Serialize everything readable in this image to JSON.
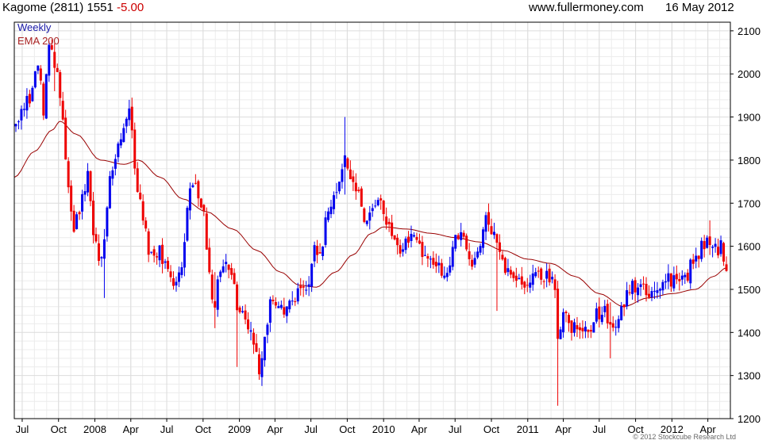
{
  "header": {
    "symbol": "Kagome (2811)",
    "price": "1551",
    "change": "-5.00",
    "site": "www.fullermoney.com",
    "date": "16 May 2012"
  },
  "legend": {
    "weekly": "Weekly",
    "ema": "EMA 200"
  },
  "copyright": "© 2012 Stockcube Research Ltd",
  "colors": {
    "up": "#0000ee",
    "down": "#ee0000",
    "ema": "#990000",
    "grid": "#dcdcdc",
    "frame": "#000000"
  },
  "chart_data": {
    "type": "candlestick",
    "ylim": [
      1200,
      2120
    ],
    "yticks": [
      1200,
      1300,
      1400,
      1500,
      1600,
      1700,
      1800,
      1900,
      2000,
      2100
    ],
    "x_range": [
      "2007-06-11",
      "2012-05-28"
    ],
    "xticks": [
      {
        "date": "2007-07-01",
        "label": "Jul"
      },
      {
        "date": "2007-10-01",
        "label": "Oct"
      },
      {
        "date": "2008-01-01",
        "label": "2008"
      },
      {
        "date": "2008-04-01",
        "label": "Apr"
      },
      {
        "date": "2008-07-01",
        "label": "Jul"
      },
      {
        "date": "2008-10-01",
        "label": "Oct"
      },
      {
        "date": "2009-01-01",
        "label": "2009"
      },
      {
        "date": "2009-04-01",
        "label": "Apr"
      },
      {
        "date": "2009-07-01",
        "label": "Jul"
      },
      {
        "date": "2009-10-01",
        "label": "Oct"
      },
      {
        "date": "2010-01-01",
        "label": "2010"
      },
      {
        "date": "2010-04-01",
        "label": "Apr"
      },
      {
        "date": "2010-07-01",
        "label": "Jul"
      },
      {
        "date": "2010-10-01",
        "label": "Oct"
      },
      {
        "date": "2011-01-01",
        "label": "2011"
      },
      {
        "date": "2011-04-01",
        "label": "Apr"
      },
      {
        "date": "2011-07-01",
        "label": "Jul"
      },
      {
        "date": "2011-10-01",
        "label": "Oct"
      },
      {
        "date": "2012-01-01",
        "label": "2012"
      },
      {
        "date": "2012-04-01",
        "label": "Apr"
      }
    ],
    "grid": true,
    "price_anchors": [
      [
        "2007-06-15",
        1885
      ],
      [
        "2007-07-20",
        1950
      ],
      [
        "2007-08-10",
        2030
      ],
      [
        "2007-08-24",
        1920
      ],
      [
        "2007-09-07",
        2060
      ],
      [
        "2007-09-28",
        2010
      ],
      [
        "2007-10-12",
        1880
      ],
      [
        "2007-10-26",
        1720
      ],
      [
        "2007-11-09",
        1640
      ],
      [
        "2007-11-30",
        1710
      ],
      [
        "2007-12-14",
        1780
      ],
      [
        "2007-12-28",
        1620
      ],
      [
        "2008-01-18",
        1560
      ],
      [
        "2008-02-08",
        1760
      ],
      [
        "2008-02-22",
        1800
      ],
      [
        "2008-03-14",
        1870
      ],
      [
        "2008-03-28",
        1930
      ],
      [
        "2008-04-11",
        1780
      ],
      [
        "2008-04-25",
        1700
      ],
      [
        "2008-05-16",
        1600
      ],
      [
        "2008-05-30",
        1560
      ],
      [
        "2008-06-13",
        1600
      ],
      [
        "2008-06-27",
        1550
      ],
      [
        "2008-07-18",
        1510
      ],
      [
        "2008-08-08",
        1540
      ],
      [
        "2008-08-22",
        1700
      ],
      [
        "2008-09-05",
        1740
      ],
      [
        "2008-09-19",
        1720
      ],
      [
        "2008-10-03",
        1680
      ],
      [
        "2008-10-17",
        1520
      ],
      [
        "2008-10-31",
        1470
      ],
      [
        "2008-11-14",
        1560
      ],
      [
        "2008-11-28",
        1570
      ],
      [
        "2008-12-12",
        1520
      ],
      [
        "2008-12-26",
        1470
      ],
      [
        "2009-01-16",
        1450
      ],
      [
        "2009-02-06",
        1370
      ],
      [
        "2009-02-20",
        1320
      ],
      [
        "2009-03-06",
        1400
      ],
      [
        "2009-03-20",
        1460
      ],
      [
        "2009-04-10",
        1460
      ],
      [
        "2009-04-24",
        1430
      ],
      [
        "2009-05-15",
        1470
      ],
      [
        "2009-05-29",
        1500
      ],
      [
        "2009-06-12",
        1490
      ],
      [
        "2009-06-26",
        1530
      ],
      [
        "2009-07-10",
        1600
      ],
      [
        "2009-07-24",
        1580
      ],
      [
        "2009-08-07",
        1650
      ],
      [
        "2009-08-21",
        1700
      ],
      [
        "2009-09-04",
        1720
      ],
      [
        "2009-09-18",
        1780
      ],
      [
        "2009-09-25",
        1820
      ],
      [
        "2009-10-09",
        1770
      ],
      [
        "2009-10-23",
        1730
      ],
      [
        "2009-11-06",
        1690
      ],
      [
        "2009-11-20",
        1640
      ],
      [
        "2009-12-04",
        1680
      ],
      [
        "2009-12-18",
        1700
      ],
      [
        "2010-01-08",
        1660
      ],
      [
        "2010-01-22",
        1640
      ],
      [
        "2010-02-05",
        1590
      ],
      [
        "2010-02-19",
        1600
      ],
      [
        "2010-03-05",
        1620
      ],
      [
        "2010-03-19",
        1630
      ],
      [
        "2010-04-02",
        1600
      ],
      [
        "2010-04-16",
        1590
      ],
      [
        "2010-04-30",
        1580
      ],
      [
        "2010-05-14",
        1570
      ],
      [
        "2010-05-28",
        1520
      ],
      [
        "2010-06-11",
        1540
      ],
      [
        "2010-06-25",
        1600
      ],
      [
        "2010-07-09",
        1630
      ],
      [
        "2010-07-23",
        1620
      ],
      [
        "2010-08-06",
        1580
      ],
      [
        "2010-08-20",
        1560
      ],
      [
        "2010-09-03",
        1610
      ],
      [
        "2010-09-17",
        1660
      ],
      [
        "2010-10-01",
        1640
      ],
      [
        "2010-10-15",
        1590
      ],
      [
        "2010-10-29",
        1560
      ],
      [
        "2010-11-12",
        1540
      ],
      [
        "2010-11-26",
        1530
      ],
      [
        "2010-12-10",
        1510
      ],
      [
        "2010-12-24",
        1520
      ],
      [
        "2011-01-14",
        1520
      ],
      [
        "2011-02-04",
        1540
      ],
      [
        "2011-02-25",
        1520
      ],
      [
        "2011-03-11",
        1510
      ],
      [
        "2011-03-18",
        1400
      ],
      [
        "2011-04-01",
        1450
      ],
      [
        "2011-04-15",
        1420
      ],
      [
        "2011-05-06",
        1400
      ],
      [
        "2011-05-20",
        1420
      ],
      [
        "2011-06-10",
        1420
      ],
      [
        "2011-06-24",
        1440
      ],
      [
        "2011-07-08",
        1460
      ],
      [
        "2011-07-22",
        1430
      ],
      [
        "2011-08-05",
        1400
      ],
      [
        "2011-08-19",
        1440
      ],
      [
        "2011-09-02",
        1470
      ],
      [
        "2011-09-16",
        1500
      ],
      [
        "2011-09-30",
        1510
      ],
      [
        "2011-10-14",
        1500
      ],
      [
        "2011-10-28",
        1490
      ],
      [
        "2011-11-11",
        1510
      ],
      [
        "2011-11-25",
        1500
      ],
      [
        "2011-12-09",
        1510
      ],
      [
        "2011-12-23",
        1520
      ],
      [
        "2012-01-13",
        1520
      ],
      [
        "2012-01-27",
        1530
      ],
      [
        "2012-02-10",
        1540
      ],
      [
        "2012-02-24",
        1560
      ],
      [
        "2012-03-09",
        1590
      ],
      [
        "2012-03-23",
        1610
      ],
      [
        "2012-04-06",
        1600
      ],
      [
        "2012-04-20",
        1590
      ],
      [
        "2012-05-04",
        1600
      ],
      [
        "2012-05-18",
        1551
      ]
    ],
    "special_wicks": [
      [
        "2009-09-25",
        1900,
        1720
      ],
      [
        "2011-03-18",
        1520,
        1230
      ],
      [
        "2008-12-26",
        1500,
        1320
      ],
      [
        "2008-10-31",
        1540,
        1410
      ],
      [
        "2008-01-25",
        1640,
        1480
      ],
      [
        "2011-07-29",
        1470,
        1340
      ],
      [
        "2007-09-21",
        2070,
        1960
      ],
      [
        "2010-10-15",
        1620,
        1450
      ],
      [
        "2012-04-06",
        1660,
        1580
      ]
    ],
    "ema_anchors": [
      [
        "2007-06-11",
        1760
      ],
      [
        "2007-08-01",
        1820
      ],
      [
        "2007-09-15",
        1870
      ],
      [
        "2007-10-05",
        1890
      ],
      [
        "2007-11-15",
        1860
      ],
      [
        "2008-01-15",
        1800
      ],
      [
        "2008-03-15",
        1790
      ],
      [
        "2008-04-20",
        1800
      ],
      [
        "2008-06-15",
        1760
      ],
      [
        "2008-08-10",
        1710
      ],
      [
        "2008-10-10",
        1680
      ],
      [
        "2008-12-15",
        1640
      ],
      [
        "2009-02-15",
        1590
      ],
      [
        "2009-04-15",
        1540
      ],
      [
        "2009-06-01",
        1510
      ],
      [
        "2009-07-15",
        1505
      ],
      [
        "2009-09-01",
        1540
      ],
      [
        "2009-10-15",
        1580
      ],
      [
        "2009-12-01",
        1630
      ],
      [
        "2010-01-01",
        1645
      ],
      [
        "2010-03-01",
        1640
      ],
      [
        "2010-05-01",
        1630
      ],
      [
        "2010-07-01",
        1620
      ],
      [
        "2010-09-01",
        1610
      ],
      [
        "2010-11-01",
        1590
      ],
      [
        "2011-01-01",
        1570
      ],
      [
        "2011-03-01",
        1560
      ],
      [
        "2011-05-01",
        1530
      ],
      [
        "2011-07-01",
        1490
      ],
      [
        "2011-09-01",
        1460
      ],
      [
        "2011-11-01",
        1480
      ],
      [
        "2012-01-01",
        1490
      ],
      [
        "2012-03-01",
        1500
      ],
      [
        "2012-04-15",
        1530
      ],
      [
        "2012-05-18",
        1550
      ]
    ]
  }
}
